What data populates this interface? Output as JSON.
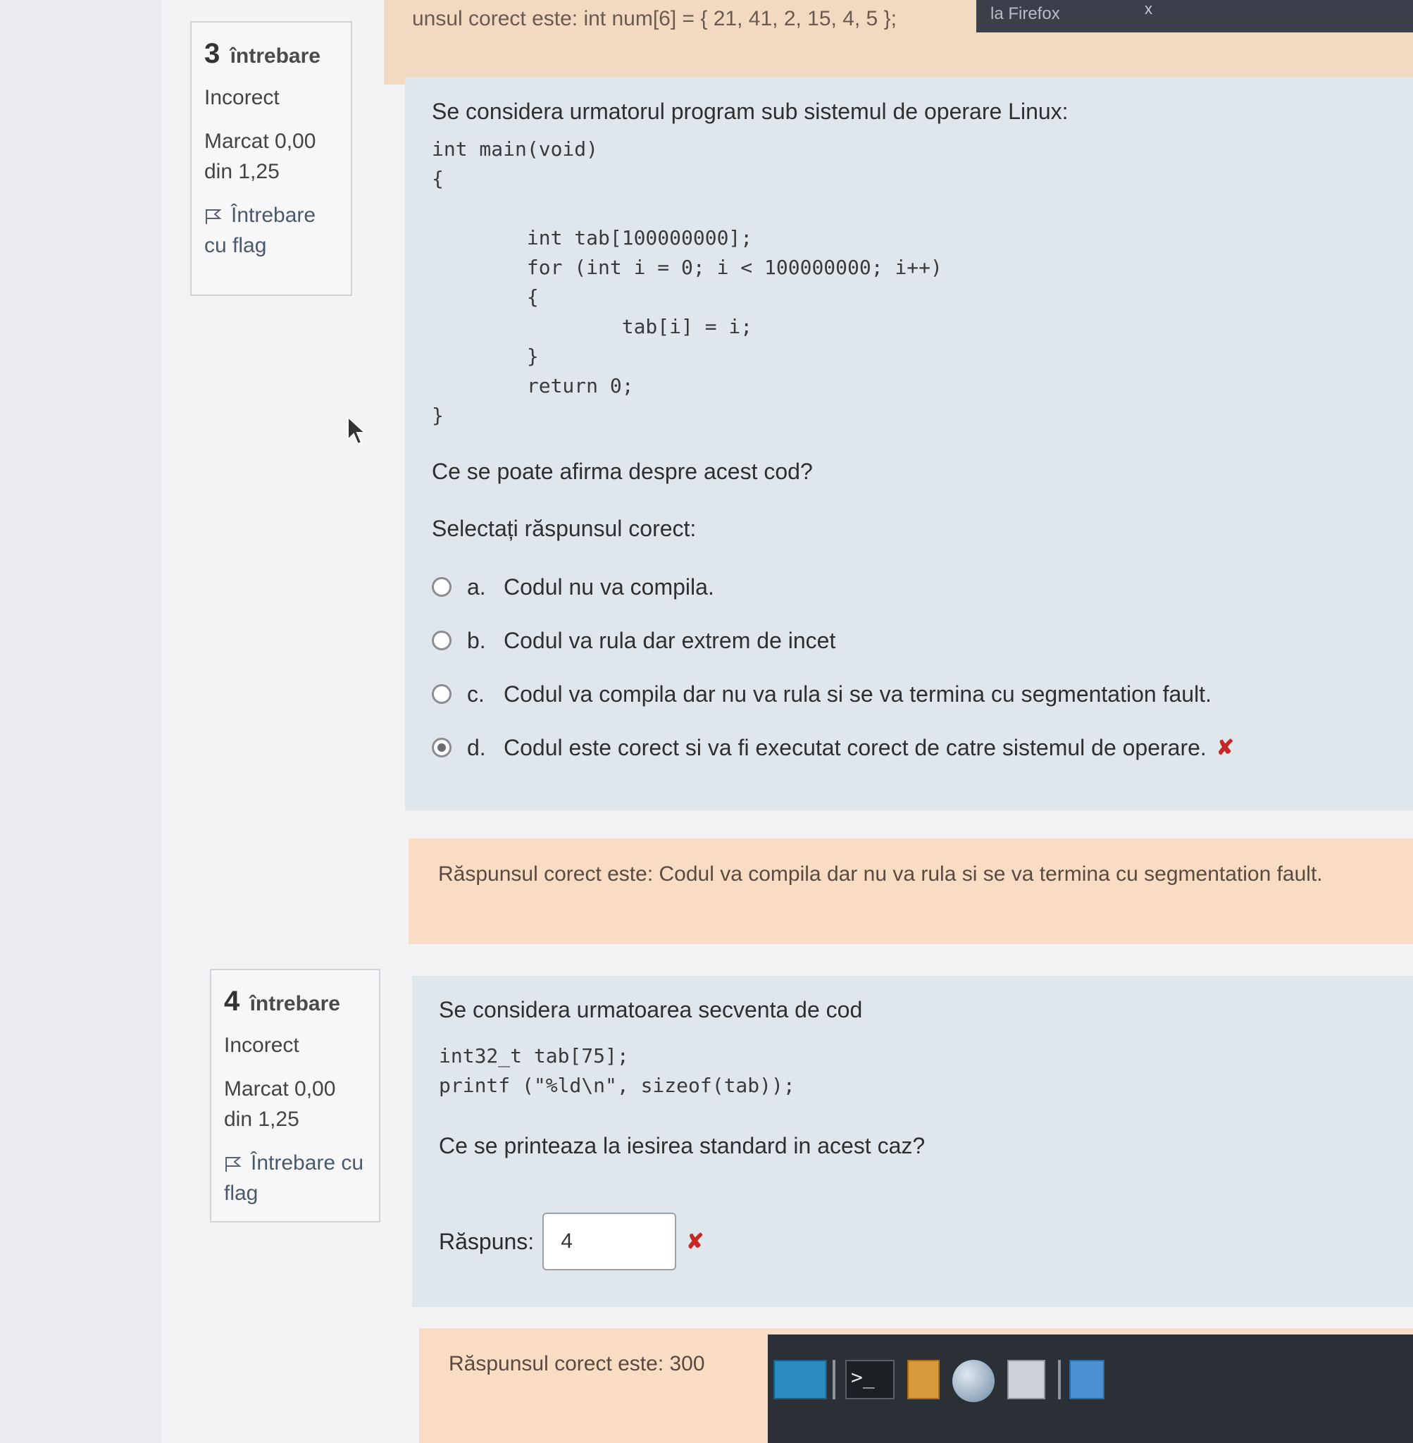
{
  "window": {
    "title": "la Firefox",
    "close": "x"
  },
  "previous": {
    "answer_text": "unsul corect este: int num[6] = { 21, 41, 2, 15, 4, 5 };"
  },
  "q3": {
    "info": {
      "number": "3",
      "label": "întrebare",
      "status": "Incorect",
      "grade": "Marcat 0,00 din 1,25",
      "flag": "Întrebare cu flag"
    },
    "intro": "Se considera urmatorul program sub sistemul de operare Linux:",
    "code": "int main(void)\n{\n\n        int tab[100000000];\n        for (int i = 0; i < 100000000; i++)\n        {\n                tab[i] = i;\n        }\n        return 0;\n}",
    "question": "Ce se poate afirma despre acest cod?",
    "select_prompt": "Selectați răspunsul corect:",
    "options": [
      {
        "letter": "a.",
        "text": "Codul nu va compila.",
        "checked": false
      },
      {
        "letter": "b.",
        "text": "Codul va rula dar extrem de incet",
        "checked": false
      },
      {
        "letter": "c.",
        "text": "Codul va compila dar nu va rula si se va termina cu segmentation fault.",
        "checked": false
      },
      {
        "letter": "d.",
        "text": "Codul este corect si va fi executat corect de catre sistemul de operare.",
        "checked": true
      }
    ],
    "wrong_mark": "✘",
    "feedback": "Răspunsul corect este: Codul va compila dar nu va rula si se va termina cu segmentation fault."
  },
  "q4": {
    "info": {
      "number": "4",
      "label": "întrebare",
      "status": "Incorect",
      "grade": "Marcat 0,00 din 1,25",
      "flag": "Întrebare cu flag"
    },
    "intro": "Se considera urmatoarea secventa de cod",
    "code": "int32_t tab[75];\nprintf (\"%ld\\n\", sizeof(tab));",
    "question": "Ce se printeaza la iesirea standard in acest caz?",
    "answer_label": "Răspuns:",
    "answer_value": "4",
    "wrong_mark": "✘",
    "feedback": "Răspunsul corect este: 300"
  },
  "taskbar": {
    "terminal_glyph": ">_"
  },
  "colors": {
    "feedback_bg": "#f8dcc3",
    "panel_bg": "#dfe6ec",
    "wrong": "#c62828"
  }
}
